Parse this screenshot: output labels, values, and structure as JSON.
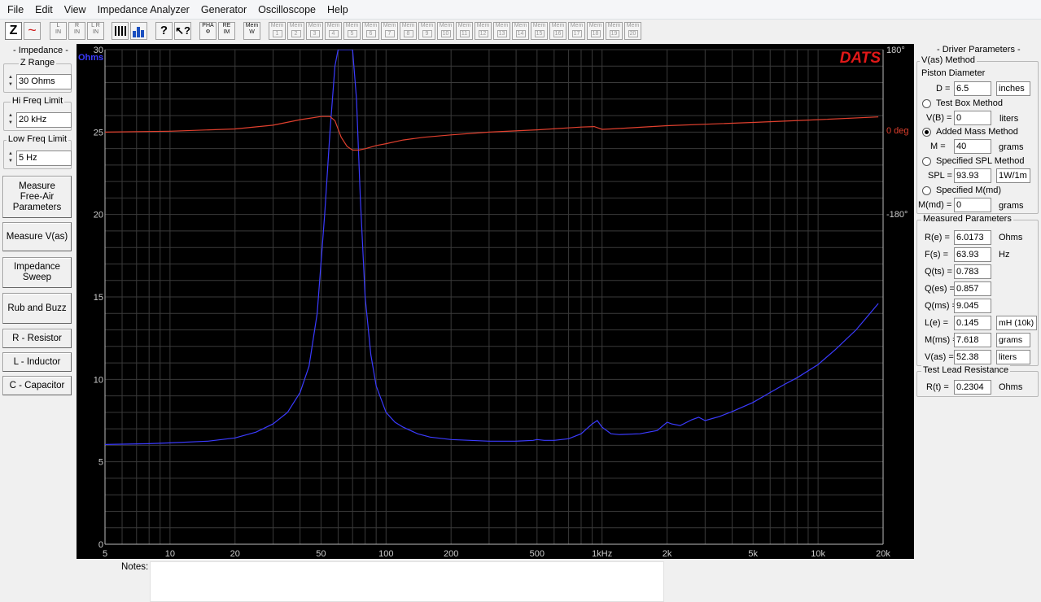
{
  "menu": [
    "File",
    "Edit",
    "View",
    "Impedance Analyzer",
    "Generator",
    "Oscilloscope",
    "Help"
  ],
  "toolbar": {
    "z_label": "Z",
    "tilde": "~",
    "l_in": "L\nIN",
    "r_in": "R\nIN",
    "lr_in": "L R\nIN",
    "pha": "PHA\nΦ",
    "reim": "RE\nIM",
    "mem_w": "Mem\nW",
    "mem_label": "Mem",
    "mem_slots": [
      "1",
      "2",
      "3",
      "4",
      "5",
      "6",
      "7",
      "8",
      "9",
      "10",
      "11",
      "12",
      "13",
      "14",
      "15",
      "16",
      "17",
      "18",
      "19",
      "20"
    ]
  },
  "left_panel": {
    "impedance_title": "- Impedance -",
    "z_range_label": "Z Range",
    "z_range_value": "30 Ohms",
    "hi_freq_label": "Hi Freq Limit",
    "hi_freq_value": "20 kHz",
    "low_freq_label": "Low Freq Limit",
    "low_freq_value": "5 Hz",
    "btn_measure_free_air": "Measure Free-Air Parameters",
    "btn_measure_vas": "Measure V(as)",
    "btn_impedance_sweep": "Impedance Sweep",
    "btn_rub_buzz": "Rub and Buzz",
    "btn_resistor": "R - Resistor",
    "btn_inductor": "L - Inductor",
    "btn_capacitor": "C - Capacitor"
  },
  "right_panel": {
    "title": "- Driver Parameters -",
    "vas_method": "V(as) Method",
    "piston_diameter": "Piston Diameter",
    "d_label": "D =",
    "d_value": "6.5",
    "d_unit": "inches",
    "test_box": "Test Box Method",
    "vb_label": "V(B) =",
    "vb_value": "0",
    "vb_unit": "liters",
    "added_mass": "Added Mass Method",
    "m_label": "M =",
    "m_value": "40",
    "m_unit": "grams",
    "spl_method": "Specified SPL Method",
    "spl_label": "SPL =",
    "spl_value": "93.93",
    "spl_unit": "1W/1m",
    "mmd_method": "Specified M(md)",
    "mmd_label": "M(md) =",
    "mmd_value": "0",
    "mmd_unit": "grams",
    "measured_title": "Measured Parameters",
    "params": [
      {
        "label": "R(e) =",
        "value": "6.0173",
        "unit": "Ohms"
      },
      {
        "label": "F(s) =",
        "value": "63.93",
        "unit": "Hz"
      },
      {
        "label": "Q(ts) =",
        "value": "0.783",
        "unit": ""
      },
      {
        "label": "Q(es) =",
        "value": "0.857",
        "unit": ""
      },
      {
        "label": "Q(ms) =",
        "value": "9.045",
        "unit": ""
      },
      {
        "label": "L(e) =",
        "value": "0.145",
        "unit": "mH (10k)"
      },
      {
        "label": "M(ms) =",
        "value": "7.618",
        "unit": "grams"
      },
      {
        "label": "V(as) =",
        "value": "52.38",
        "unit": "liters"
      }
    ],
    "lead_title": "Test Lead Resistance",
    "rt_label": "R(t) =",
    "rt_value": "0.2304",
    "rt_unit": "Ohms"
  },
  "notes_label": "Notes:",
  "chart_data": {
    "type": "line",
    "brand": "DATS",
    "y_unit_label": "Ohms",
    "x_scale": "log",
    "xlim": [
      5,
      20000
    ],
    "ylim": [
      0,
      30
    ],
    "y_ticks": [
      0,
      5,
      10,
      15,
      20,
      25,
      30
    ],
    "y_tick_labels": [
      "0",
      "5",
      "10",
      "15",
      "20",
      "25",
      "30"
    ],
    "x_ticks": [
      5,
      10,
      20,
      50,
      100,
      200,
      500,
      1000,
      2000,
      5000,
      10000,
      20000
    ],
    "x_tick_labels": [
      "5",
      "10",
      "20",
      "50",
      "100",
      "200",
      "500",
      "1kHz",
      "2k",
      "5k",
      "10k",
      "20k"
    ],
    "phase_axis_labels": [
      "180°",
      "0 deg",
      "-180°"
    ],
    "phase_range": [
      -180,
      180
    ],
    "grid": true,
    "colors": {
      "impedance": "#3b3bff",
      "phase": "#e0402e",
      "brand": "#e01818",
      "grid": "#3a3a3a",
      "ohms_label": "#3b3bff",
      "phase_label": "#e0402e"
    },
    "series": [
      {
        "key": "impedance",
        "x": [
          5,
          8,
          10,
          15,
          20,
          25,
          30,
          35,
          40,
          44,
          48,
          52,
          55,
          58,
          60,
          62,
          63.93,
          66,
          68,
          70,
          73,
          76,
          80,
          85,
          90,
          100,
          110,
          120,
          140,
          160,
          200,
          300,
          400,
          480,
          500,
          540,
          600,
          700,
          800,
          900,
          950,
          1000,
          1100,
          1200,
          1500,
          1800,
          2000,
          2100,
          2300,
          2600,
          2800,
          3000,
          3500,
          4000,
          5000,
          6000,
          7000,
          8000,
          10000,
          12000,
          15000,
          19000
        ],
        "y": [
          6.05,
          6.1,
          6.15,
          6.25,
          6.45,
          6.8,
          7.3,
          8.0,
          9.2,
          10.8,
          14.0,
          20.0,
          25.0,
          29.0,
          30,
          30,
          30,
          30,
          30,
          30,
          27.0,
          21.0,
          15.0,
          11.5,
          9.6,
          8.0,
          7.4,
          7.1,
          6.7,
          6.5,
          6.35,
          6.25,
          6.25,
          6.3,
          6.35,
          6.3,
          6.3,
          6.4,
          6.7,
          7.3,
          7.5,
          7.1,
          6.7,
          6.65,
          6.7,
          6.9,
          7.4,
          7.3,
          7.2,
          7.55,
          7.7,
          7.5,
          7.75,
          8.05,
          8.6,
          9.2,
          9.7,
          10.1,
          10.9,
          11.8,
          13.0,
          14.6
        ]
      },
      {
        "key": "phase",
        "x": [
          5,
          10,
          20,
          30,
          40,
          50,
          55,
          58,
          62,
          66,
          70,
          75,
          80,
          90,
          100,
          120,
          150,
          200,
          300,
          500,
          800,
          920,
          1000,
          1100,
          2000,
          5000,
          10000,
          19000
        ],
        "y": [
          1,
          3,
          8,
          16,
          28,
          35,
          35,
          26,
          -10,
          -30,
          -38,
          -38,
          -35,
          -28,
          -24,
          -16,
          -10,
          -5,
          1,
          6,
          12,
          13,
          7,
          8,
          15,
          22,
          28,
          34
        ]
      }
    ]
  }
}
